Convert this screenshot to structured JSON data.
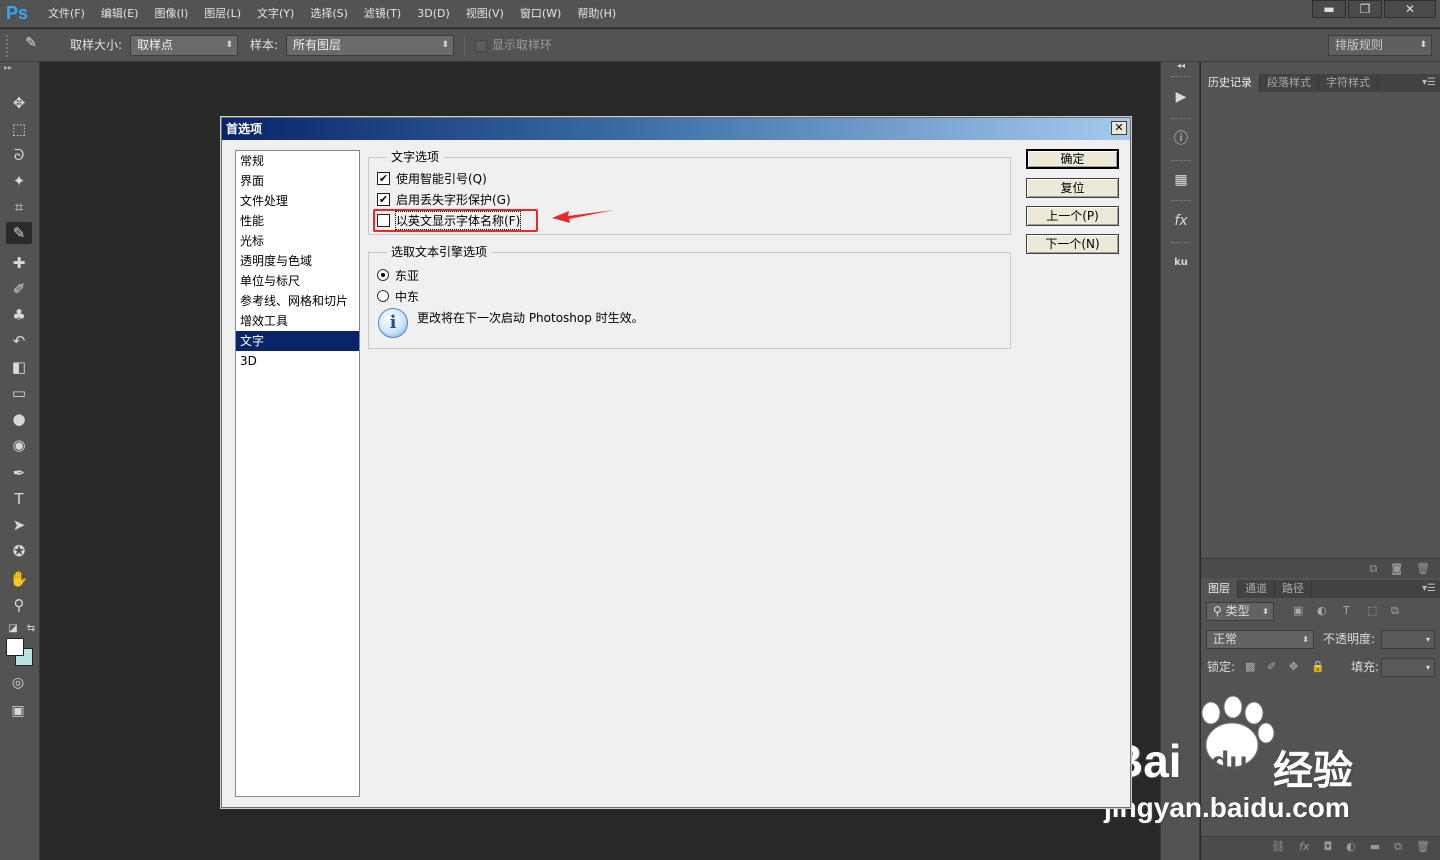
{
  "app": {
    "logo": "Ps"
  },
  "menu": [
    "文件(F)",
    "编辑(E)",
    "图像(I)",
    "图层(L)",
    "文字(Y)",
    "选择(S)",
    "滤镜(T)",
    "3D(D)",
    "视图(V)",
    "窗口(W)",
    "帮助(H)"
  ],
  "window_controls": {
    "minimize": "▬",
    "restore": "❐",
    "close": "✕"
  },
  "options_bar": {
    "sample_size_label": "取样大小:",
    "sample_size_value": "取样点",
    "sample_label": "样本:",
    "sample_value": "所有图层",
    "show_ring_label": "显示取样环",
    "workspace_value": "排版规则"
  },
  "tools": [
    {
      "name": "move-tool-icon",
      "glyph": "✥"
    },
    {
      "name": "marquee-tool-icon",
      "glyph": "⬚"
    },
    {
      "name": "lasso-tool-icon",
      "glyph": "ᘐ"
    },
    {
      "name": "magic-wand-tool-icon",
      "glyph": "✦"
    },
    {
      "name": "crop-tool-icon",
      "glyph": "⌗"
    },
    {
      "name": "eyedropper-tool-icon",
      "glyph": "✎"
    },
    {
      "name": "healing-brush-tool-icon",
      "glyph": "✚"
    },
    {
      "name": "brush-tool-icon",
      "glyph": "✐"
    },
    {
      "name": "clone-stamp-tool-icon",
      "glyph": "♣"
    },
    {
      "name": "history-brush-tool-icon",
      "glyph": "↶"
    },
    {
      "name": "eraser-tool-icon",
      "glyph": "◧"
    },
    {
      "name": "gradient-tool-icon",
      "glyph": "▭"
    },
    {
      "name": "blur-tool-icon",
      "glyph": "●"
    },
    {
      "name": "dodge-tool-icon",
      "glyph": "◉"
    },
    {
      "name": "pen-tool-icon",
      "glyph": "✒"
    },
    {
      "name": "type-tool-icon",
      "glyph": "T"
    },
    {
      "name": "path-selection-tool-icon",
      "glyph": "➤"
    },
    {
      "name": "shape-tool-icon",
      "glyph": "✪"
    },
    {
      "name": "hand-tool-icon",
      "glyph": "✋"
    },
    {
      "name": "zoom-tool-icon",
      "glyph": "⚲"
    }
  ],
  "swatches": {
    "foreground": "#ffffff",
    "background": "#b7e4e2"
  },
  "history_panel": {
    "tabs": [
      "历史记录",
      "段落样式",
      "字符样式"
    ]
  },
  "layers_panel": {
    "tabs": [
      "图层",
      "通道",
      "路径"
    ],
    "filter_value": "类型",
    "blend_mode": "正常",
    "opacity_label": "不透明度:",
    "lock_label": "锁定:",
    "fill_label": "填充:"
  },
  "dialog": {
    "title": "首选项",
    "close_label": "✕",
    "categories": [
      "常规",
      "界面",
      "文件处理",
      "性能",
      "光标",
      "透明度与色域",
      "单位与标尺",
      "参考线、网格和切片",
      "增效工具",
      "文字",
      "3D"
    ],
    "selected_category": "文字",
    "type_options": {
      "legend": "文字选项",
      "smart_quotes": {
        "label": "使用智能引号(Q)",
        "checked": true
      },
      "missing_glyph": {
        "label": "启用丢失字形保护(G)",
        "checked": true
      },
      "english_font_names": {
        "label": "以英文显示字体名称(F)",
        "checked": false
      }
    },
    "text_engine": {
      "legend": "选取文本引擎选项",
      "east_asian": {
        "label": "东亚",
        "selected": true
      },
      "middle_eastern": {
        "label": "中东",
        "selected": false
      },
      "info": "更改将在下一次启动 Photoshop 时生效。"
    },
    "buttons": {
      "ok": "确定",
      "reset": "复位",
      "prev": "上一个(P)",
      "next": "下一个(N)"
    }
  },
  "watermark": {
    "logo_text": "Bai",
    "logo_text2": "du",
    "logo_cn": "经验",
    "url": "jingyan.baidu.com"
  }
}
